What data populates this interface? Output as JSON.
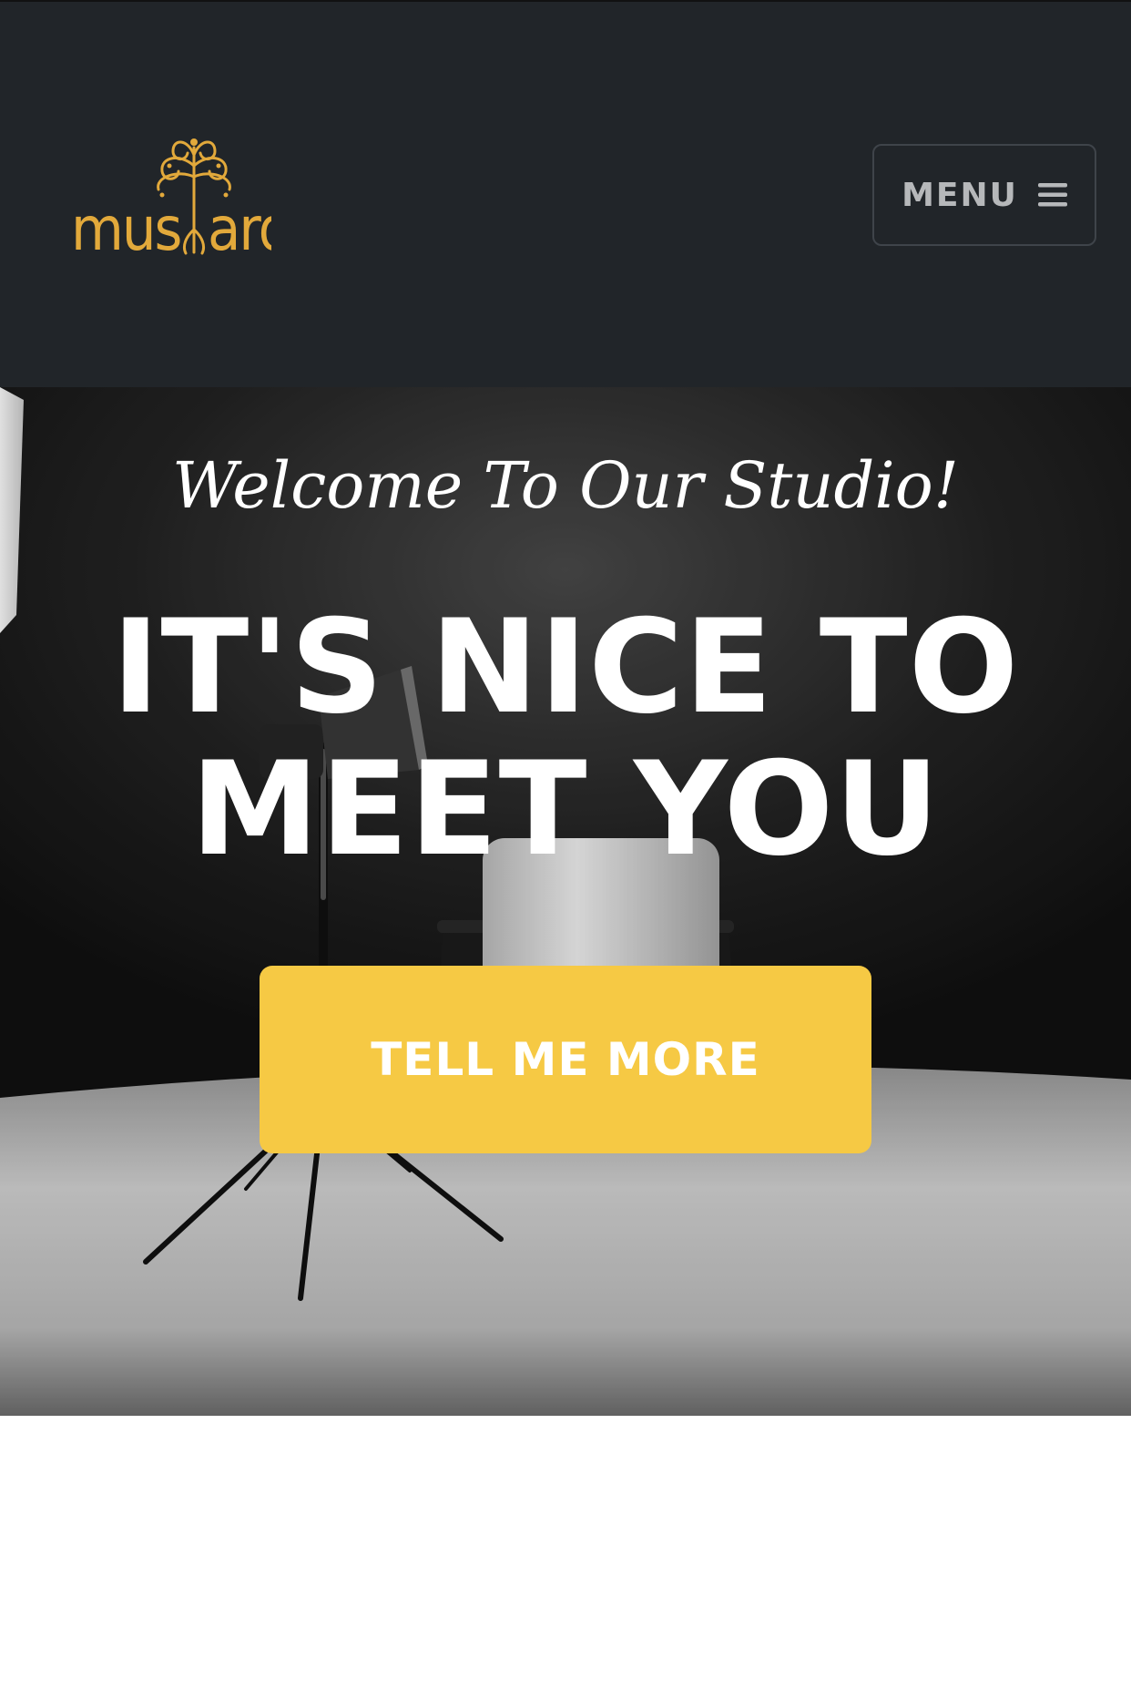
{
  "navbar": {
    "brand_name": "mustard",
    "brand_color": "#e2a93b",
    "background_color": "#212529",
    "menu_label": "MENU",
    "menu_icon": "hamburger-icon"
  },
  "hero": {
    "subheading": "Welcome To Our Studio!",
    "heading_line1": "IT'S NICE TO",
    "heading_line2": "MEET YOU",
    "button_label": "TELL ME MORE",
    "button_color": "#f6c944",
    "background_image": "photo-studio-chair-and-lights"
  }
}
